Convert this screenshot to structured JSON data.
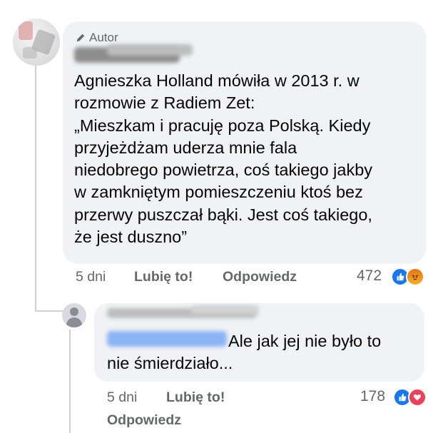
{
  "main_comment": {
    "author_badge": "Autor",
    "text": "Agnieszka Holland mówiła w 2013 r. w\nrozmowie z Radiem Zet:\n„Mieszkam i pracuję poza Polską. Kiedy\nprzyjeżdżam uderza mnie fala\nniedobrego powietrza, coś takiego jakby\nw zamkniętym pomieszczeniu ktoś bez\nprzerwy puszczał bąki. Jest coś takiego,\nże jest duszno”",
    "time": "5 dni",
    "like_label": "Lubię to!",
    "reply_label": "Odpowiedz",
    "reaction_count": "472",
    "reactions": [
      "like-icon",
      "angry-icon"
    ]
  },
  "reply_comment": {
    "text": "Ale jak jej nie było to\nnie śmierdziało...",
    "time": "5 dni",
    "like_label": "Lubię to!",
    "reply_label": "Odpowiedz",
    "reaction_count": "178",
    "reactions": [
      "like-icon",
      "love-icon"
    ]
  },
  "colors": {
    "bubble": "#f0f2f5",
    "meta_text": "#65676b",
    "like_blue": "#1877f2",
    "love_red": "#f33e58",
    "angry_orange": "#e9710f"
  }
}
